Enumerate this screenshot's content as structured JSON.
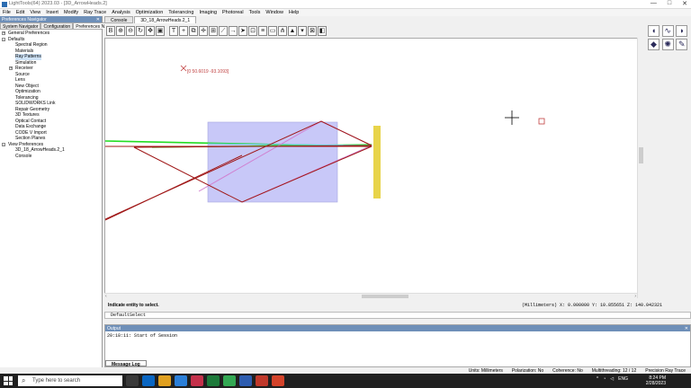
{
  "window": {
    "title": "LightTools(64) 2023.03 - [3D_ArrowHeads.2]",
    "controls": [
      "—",
      "□",
      "✕"
    ]
  },
  "menu": [
    "File",
    "Edit",
    "View",
    "Insert",
    "Modify",
    "Ray Trace",
    "Analysis",
    "Optimization",
    "Tolerancing",
    "Imaging",
    "Photoreal",
    "Tools",
    "Window",
    "Help"
  ],
  "left_panel": {
    "title": "Preferences Navigator",
    "tabs": [
      "System Navigator",
      "Configuration",
      "Preferences Na..."
    ],
    "tree": [
      {
        "label": "General Preferences",
        "level": 0,
        "exp": "+"
      },
      {
        "label": "Defaults",
        "level": 0,
        "exp": "-"
      },
      {
        "label": "Spectral Region",
        "level": 1
      },
      {
        "label": "Materials",
        "level": 1
      },
      {
        "label": "Ray Patterns",
        "level": 1,
        "selected": true
      },
      {
        "label": "Simulation",
        "level": 1
      },
      {
        "label": "Receiver",
        "level": 1,
        "exp": "+"
      },
      {
        "label": "Source",
        "level": 1
      },
      {
        "label": "Lens",
        "level": 1
      },
      {
        "label": "New Object",
        "level": 1
      },
      {
        "label": "Optimization",
        "level": 1
      },
      {
        "label": "Tolerancing",
        "level": 1
      },
      {
        "label": "SOLIDWORKS Link",
        "level": 1
      },
      {
        "label": "Repair Geometry",
        "level": 1
      },
      {
        "label": "3D Textures",
        "level": 1
      },
      {
        "label": "Optical Contact",
        "level": 1
      },
      {
        "label": "Data Exchange",
        "level": 1
      },
      {
        "label": "CODE V Import",
        "level": 1
      },
      {
        "label": "Section Planes",
        "level": 1
      },
      {
        "label": "View Preferences",
        "level": 0,
        "exp": "-"
      },
      {
        "label": "3D_18_ArrowHeads.2_1",
        "level": 1
      },
      {
        "label": "Console",
        "level": 1
      }
    ]
  },
  "doc_tabs": [
    "Console",
    "3D_18_ArrowHeads.2_1"
  ],
  "viewport": {
    "coord_label": "[0 50.6019 -93.1093]",
    "colors": {
      "lens": "#c8c8f8",
      "detector": "#e8d44a",
      "ray_red": "#a01818",
      "ray_pink": "#d080d0",
      "ray_green": "#22dd22",
      "ray_cyan": "#66c8e0"
    }
  },
  "prompt": "Indicate entity to select.",
  "coords": "(Millimeters)  X:    0.000000  Y:   10.855651  Z:  140.042321",
  "command_line": "DefaultSelect",
  "output": {
    "title": "Output",
    "lines": [
      "20:18:11: Start of Session"
    ],
    "tabs": [
      "Message Log"
    ]
  },
  "app_status": {
    "units": "Units: Millimeters",
    "polarization": "Polarization: No",
    "coherence": "Coherence: No",
    "multithreading": "Multithreading: 12 / 12",
    "precision": "Precision Ray Trace"
  },
  "taskbar": {
    "search_placeholder": "Type here to search",
    "time": "8:24 PM",
    "date": "2/28/2023",
    "lang": "ENG"
  }
}
